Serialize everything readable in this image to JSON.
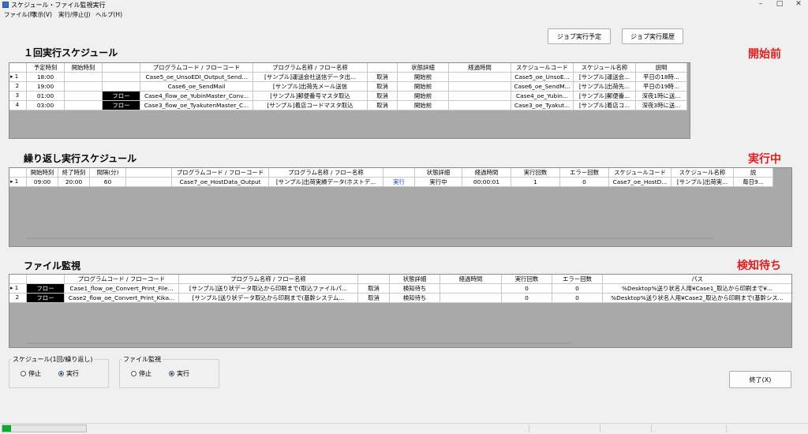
{
  "window": {
    "title": "スケジュール・ファイル監視実行",
    "icon": "app-icon",
    "controls": [
      "minimize-icon",
      "maximize-icon",
      "close-icon"
    ]
  },
  "menu": [
    "ファイル(F)",
    "表示(V)",
    "実行/停止(J)",
    "ヘルプ(H)"
  ],
  "buttons": {
    "schedule": "ジョブ実行予定",
    "history": "ジョブ実行履歴",
    "exit": "終了(X)"
  },
  "accent": {
    "state_color": "#e31b1b",
    "flow_bg": "#000000",
    "progress": "#06b025",
    "link": "#1a3fd4"
  },
  "once": {
    "title": "１回実行スケジュール",
    "state": "開始前",
    "headers": [
      "予定時刻",
      "開始時刻",
      "",
      "プログラムコード / フローコード",
      "プログラム名称 / フロー名称",
      "",
      "状態詳細",
      "経過時間",
      "スケジュールコード",
      "スケジュール名称",
      "説明"
    ],
    "rows": [
      {
        "idx": "1",
        "current": true,
        "cells": [
          "18:00",
          "",
          "",
          "Case5_oe_UnsoEDI_Output_Send...",
          "[サンプル]運送会社送信データ出...",
          "取消",
          "開始前",
          "",
          "Case5_oe_UnsoE...",
          "[サンプル]運送会...",
          "平日の18時..."
        ]
      },
      {
        "idx": "2",
        "current": false,
        "cells": [
          "19:00",
          "",
          "",
          "Case6_oe_SendMail",
          "[サンプル]出荷先メール送信",
          "取消",
          "開始前",
          "",
          "Case6_oe_SendM...",
          "[サンプル]出荷先...",
          "平日の19時..."
        ]
      },
      {
        "idx": "3",
        "current": false,
        "cells": [
          "01:00",
          "",
          "フロー",
          "Case4_flow_oe_YubinMaster_Conv...",
          "[サンプル]郵便番号マスタ取込",
          "取消",
          "開始前",
          "",
          "Case4_oe_Yubin...",
          "[サンプル]郵便番...",
          "深夜1時に送..."
        ]
      },
      {
        "idx": "4",
        "current": false,
        "cells": [
          "03:00",
          "",
          "フロー",
          "Case3_flow_oe_TyakutenMaster_C...",
          "[サンプル]着店コードマスタ取込",
          "取消",
          "開始前",
          "",
          "Case3_oe_Tyakut...",
          "[サンプル]着店コ...",
          "深夜3時に送..."
        ]
      }
    ]
  },
  "repeat": {
    "title": "繰り返し実行スケジュール",
    "state": "実行中",
    "headers": [
      "開始時刻",
      "終了時刻",
      "間隔(分)",
      "",
      "プログラムコード / フローコード",
      "プログラム名称 / フロー名称",
      "",
      "状態詳細",
      "経過時間",
      "実行回数",
      "エラー回数",
      "スケジュールコード",
      "スケジュール名称",
      "説"
    ],
    "rows": [
      {
        "idx": "1",
        "current": true,
        "cells": [
          "09:00",
          "20:00",
          "60",
          "",
          "Case7_oe_HostData_Output",
          "[サンプル]出荷実績データ(ホストデ...",
          "実行",
          "実行中",
          "00:00:01",
          "1",
          "0",
          "Case7_oe_HostD...",
          "[サンプル]出荷実...",
          "毎日9..."
        ]
      }
    ]
  },
  "watch": {
    "title": "ファイル監視",
    "state": "検知待ち",
    "headers": [
      "",
      "プログラムコード / フローコード",
      "プログラム名称 / フロー名称",
      "",
      "状態詳細",
      "経過時間",
      "実行回数",
      "エラー回数",
      "パス"
    ],
    "rows": [
      {
        "idx": "1",
        "current": true,
        "cells": [
          "フロー",
          "Case1_flow_oe_Convert_Print_File...",
          "[サンプル]送り状データ取込から印刷まで(取込ファイルパ...",
          "取消",
          "検知待ち",
          "",
          "0",
          "0",
          "%Desktop%送り状名人用¥Case1_取込から印刷まで¥..."
        ]
      },
      {
        "idx": "2",
        "current": false,
        "cells": [
          "フロー",
          "Case2_flow_oe_Convert_Print_Kika...",
          "[サンプル]送り状データ取込から印刷まで(基幹システム...",
          "取消",
          "検知待ち",
          "",
          "0",
          "0",
          "%Desktop%送り状名人用¥Case2_取込から印刷まで(基幹シス..."
        ]
      }
    ]
  },
  "groups": {
    "schedule": {
      "title": "スケジュール(1回/繰り返し)",
      "stop": "停止",
      "run": "実行",
      "selected": "run"
    },
    "watch": {
      "title": "ファイル監視",
      "stop": "停止",
      "run": "実行",
      "selected": "run"
    }
  },
  "status": {
    "progress_fraction": 0.1
  }
}
